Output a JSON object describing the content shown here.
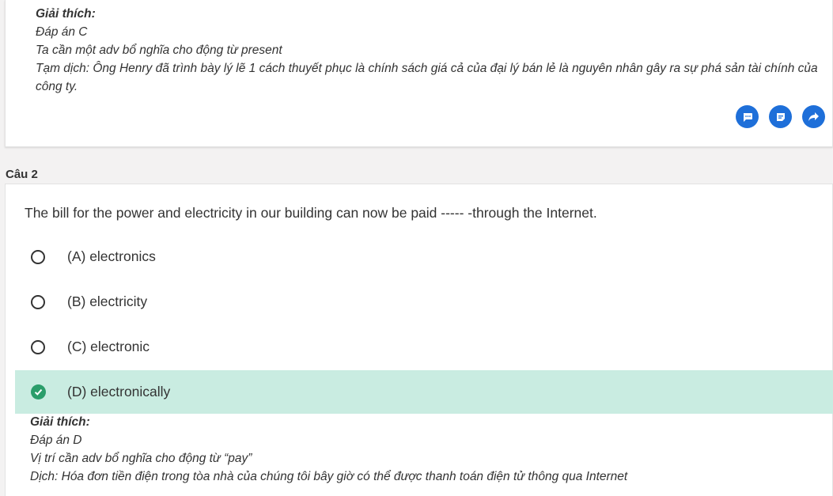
{
  "prev_explanation": {
    "title": "Giải thích:",
    "lines": [
      "Đáp án C",
      "Ta cần một adv bổ nghĩa cho động từ present",
      "Tạm dịch: Ông Henry đã trình bày lý lẽ 1 cách thuyết phục là chính sách giá cả của đại lý bán lẻ là nguyên nhân gây ra sự phá sản tài chính của công ty."
    ]
  },
  "actions": [
    "comment-icon",
    "note-icon",
    "share-icon"
  ],
  "question": {
    "label": "Câu 2",
    "text": "The bill for the power and electricity in our building can now be paid ----- -through the Internet.",
    "options": [
      {
        "label": "(A) electronics",
        "correct": false
      },
      {
        "label": "(B) electricity",
        "correct": false
      },
      {
        "label": "(C) electronic",
        "correct": false
      },
      {
        "label": "(D) electronically",
        "correct": true
      }
    ],
    "explanation": {
      "title": "Giải thích:",
      "lines": [
        "Đáp án D",
        "Vị trí cần adv bổ nghĩa cho động từ “pay”",
        "Dịch: Hóa đơn tiền điện trong tòa nhà của chúng tôi bây giờ có thể được thanh toán điện tử thông qua Internet"
      ]
    }
  },
  "colors": {
    "accent": "#1e6fd9",
    "correct_bg": "#c9ece1",
    "check": "#2a9d6a"
  }
}
